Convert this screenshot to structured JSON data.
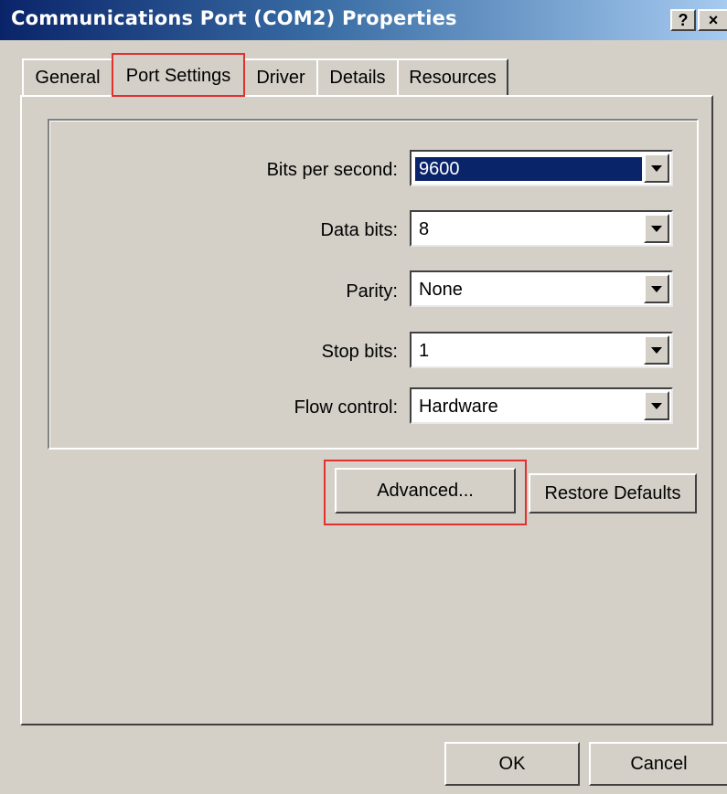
{
  "window": {
    "title": "Communications Port (COM2) Properties",
    "help_button": "?",
    "close_button": "×"
  },
  "tabs": [
    {
      "label": "General",
      "active": false
    },
    {
      "label": "Port Settings",
      "active": true
    },
    {
      "label": "Driver",
      "active": false
    },
    {
      "label": "Details",
      "active": false
    },
    {
      "label": "Resources",
      "active": false
    }
  ],
  "settings": {
    "bits_per_second": {
      "label": "Bits per second:",
      "value": "9600"
    },
    "data_bits": {
      "label": "Data bits:",
      "value": "8"
    },
    "parity": {
      "label": "Parity:",
      "value": "None"
    },
    "stop_bits": {
      "label": "Stop bits:",
      "value": "1"
    },
    "flow_control": {
      "label": "Flow control:",
      "value": "Hardware"
    }
  },
  "buttons": {
    "advanced": "Advanced...",
    "restore_defaults": "Restore Defaults",
    "ok": "OK",
    "cancel": "Cancel"
  },
  "colors": {
    "face": "#d4d0c8",
    "title_start": "#0a246a",
    "title_end": "#a6caf0",
    "selection": "#0a246a",
    "highlight_box": "#e03030"
  }
}
